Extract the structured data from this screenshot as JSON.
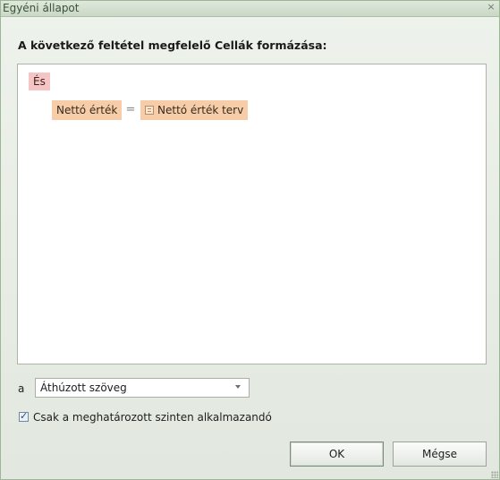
{
  "window": {
    "title": "Egyéni állapot",
    "close_glyph": "×"
  },
  "dialog": {
    "heading": "A következő feltétel megfelelő Cellák formázása:"
  },
  "filter": {
    "group_operator": "És",
    "condition": {
      "left_field": "Nettó érték",
      "operator": "=",
      "right_field": "Nettó érték terv",
      "right_icon": "list-icon"
    }
  },
  "format": {
    "label": "a",
    "selected": "Áthúzott szöveg"
  },
  "checkbox": {
    "label": "Csak a meghatározott szinten alkalmazandó",
    "checked": true
  },
  "buttons": {
    "ok": "OK",
    "cancel": "Mégse"
  },
  "colors": {
    "group_chip": "#f4c5c4",
    "field_chip": "#f6cda8",
    "titlebar": "#c9d8c4"
  }
}
